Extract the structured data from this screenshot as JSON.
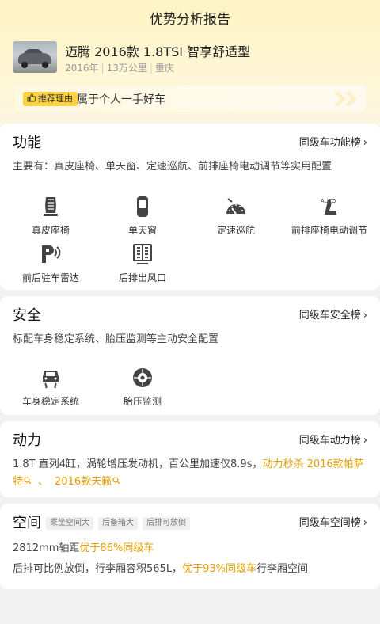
{
  "page": {
    "title": "优势分析报告"
  },
  "car": {
    "name": "迈腾 2016款 1.8TSI 智享舒适型",
    "year": "2016年",
    "mileage": "13万公里",
    "city": "重庆"
  },
  "reason": {
    "tag": "推荐理由",
    "text": "属于个人一手好车"
  },
  "function": {
    "title": "功能",
    "rank": "同级车功能榜",
    "desc": "主要有：真皮座椅、单天窗、定速巡航、前排座椅电动调节等实用配置",
    "features": [
      {
        "label": "真皮座椅",
        "icon": "leather-seat-icon"
      },
      {
        "label": "单天窗",
        "icon": "sunroof-icon"
      },
      {
        "label": "定速巡航",
        "icon": "cruise-control-icon"
      },
      {
        "label": "前排座椅电动调节",
        "icon": "power-seat-icon"
      },
      {
        "label": "前后驻车雷达",
        "icon": "parking-radar-icon"
      },
      {
        "label": "后排出风口",
        "icon": "rear-vent-icon"
      }
    ]
  },
  "safety": {
    "title": "安全",
    "rank": "同级车安全榜",
    "desc": "标配车身稳定系统、胎压监测等主动安全配置",
    "features": [
      {
        "label": "车身稳定系统",
        "icon": "stability-control-icon"
      },
      {
        "label": "胎压监测",
        "icon": "tire-pressure-icon"
      }
    ]
  },
  "power": {
    "title": "动力",
    "rank": "同级车动力榜",
    "desc_prefix": "1.8T 直列4缸，涡轮增压发动机，百公里加速仅8.9s，",
    "desc_hl1": "动力秒杀 2016款帕萨特",
    "desc_sep": "、",
    "desc_hl2": "2016款天籁"
  },
  "space": {
    "title": "空间",
    "rank": "同级车空间榜",
    "tags": [
      "乘坐空间大",
      "后备箱大",
      "后排可放倒"
    ],
    "line1_prefix": "2812mm轴距",
    "line1_hl": "优于86%同级车",
    "line2_prefix": "后排可比例放倒，行李厢容积565L，",
    "line2_hl": "优于93%同级车",
    "line2_suffix": "行李厢空间"
  },
  "colors": {
    "accent": "#e5a000",
    "tag_yellow": "#ffd33f"
  }
}
